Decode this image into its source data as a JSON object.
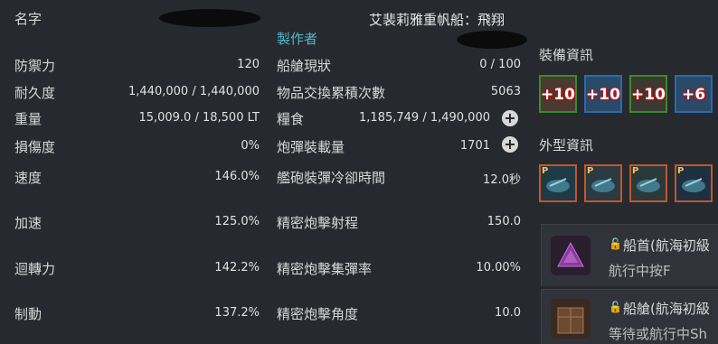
{
  "header": {
    "name_label": "名字",
    "ship_name": "艾裴莉雅重帆船：飛翔",
    "maker_label": "製作者"
  },
  "left_stats": [
    {
      "label": "防禦力",
      "value": "120"
    },
    {
      "label": "耐久度",
      "value": "1,440,000 / 1,440,000"
    },
    {
      "label": "重量",
      "value": "15,009.0 / 18,500 LT"
    },
    {
      "label": "損傷度",
      "value": "0%"
    },
    {
      "label": "速度",
      "value": "146.0%"
    },
    {
      "label": "加速",
      "value": "125.0%"
    },
    {
      "label": "迴轉力",
      "value": "142.2%"
    },
    {
      "label": "制動",
      "value": "137.2%"
    }
  ],
  "right_stats": [
    {
      "label": "船艙現狀",
      "value": "0 / 100"
    },
    {
      "label": "物品交換累積次數",
      "value": "5063"
    },
    {
      "label": "糧食",
      "value": "1,185,749 / 1,490,000"
    },
    {
      "label": "炮彈裝載量",
      "value": "1701"
    },
    {
      "label": "艦砲裝彈冷卻時間",
      "value": "12.0秒"
    },
    {
      "label": "精密炮擊射程",
      "value": "150.0"
    },
    {
      "label": "精密炮擊集彈率",
      "value": "10.00%"
    },
    {
      "label": "精密炮擊角度",
      "value": "10.0"
    }
  ],
  "equipment": {
    "title": "裝備資訊",
    "slots": [
      {
        "enchant": "+10",
        "border": "#3a8a2a",
        "icon": "ship-bow-icon"
      },
      {
        "enchant": "+10",
        "border": "#2a6ab0",
        "icon": "ship-statue-icon"
      },
      {
        "enchant": "+10",
        "border": "#3a8a2a",
        "icon": "ship-cannon-icon"
      },
      {
        "enchant": "+6",
        "border": "#2a6ab0",
        "icon": "ship-sail-icon"
      }
    ]
  },
  "appearance": {
    "title": "外型資訊",
    "slots": [
      {
        "badge": "P",
        "icon": "hull-paint-icon"
      },
      {
        "badge": "P",
        "icon": "figurehead-skin-icon"
      },
      {
        "badge": "P",
        "icon": "cannon-skin-icon"
      },
      {
        "badge": "P",
        "icon": "sail-skin-icon"
      }
    ]
  },
  "skills": [
    {
      "title": "船首(航海初級",
      "desc": "航行中按F",
      "icon": "bow-skill-icon"
    },
    {
      "title": "船艙(航海初級",
      "desc": "等待或航行中Sh",
      "icon": "cabin-skill-icon"
    }
  ]
}
